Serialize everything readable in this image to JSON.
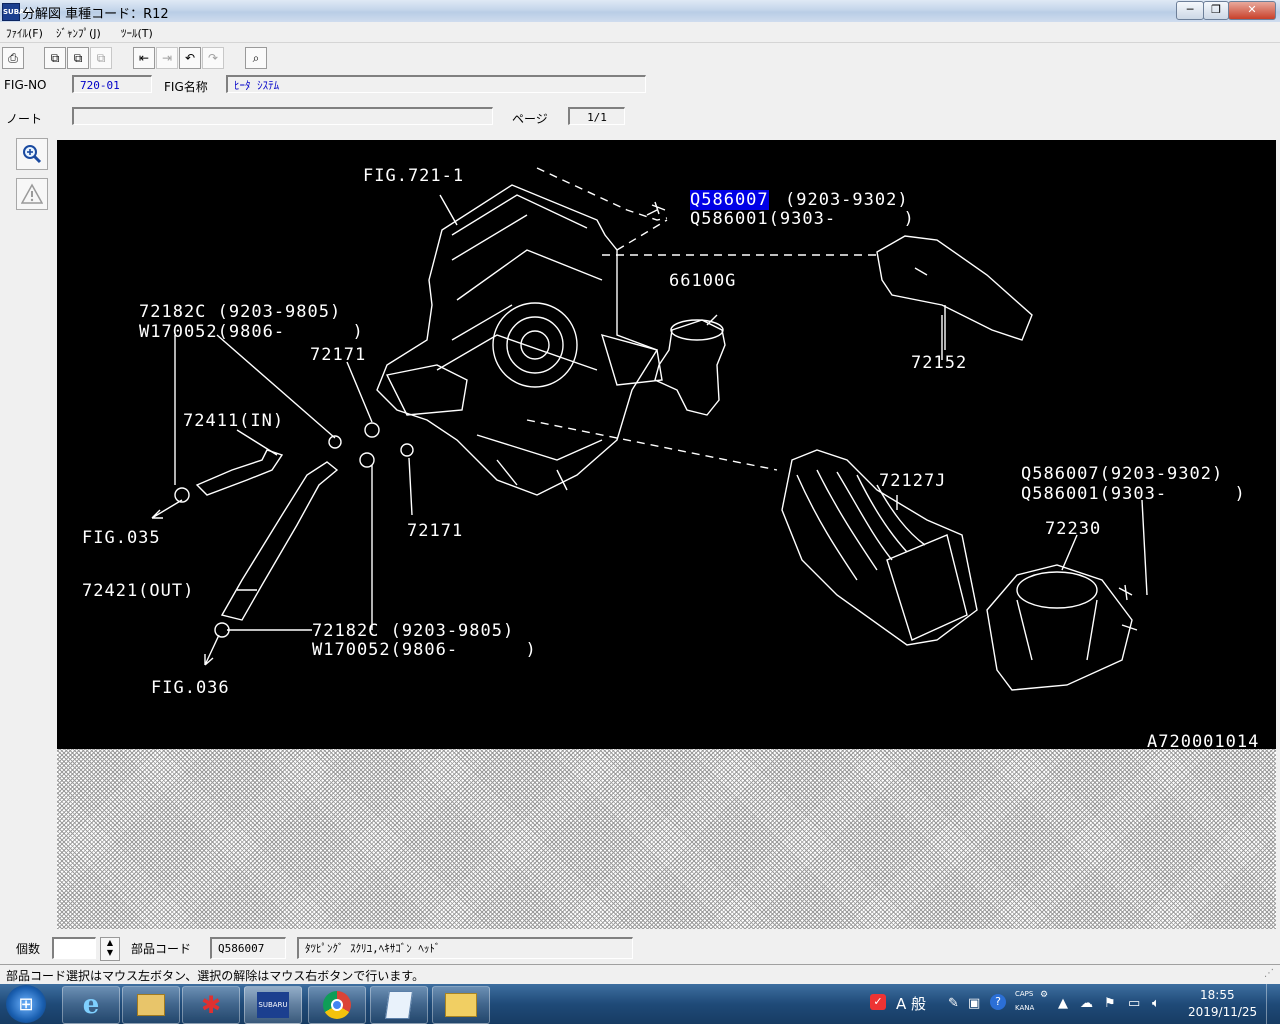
{
  "window": {
    "title": "分解図 車種コード：R12",
    "app_icon_text": "SUBARU",
    "min": "─",
    "max": "❐",
    "close": "✕"
  },
  "menu": [
    "ﾌｧｲﾙ(F)",
    "ｼﾞｬﾝﾌﾟ(J)",
    "ﾂｰﾙ(T)"
  ],
  "fig": {
    "no_label": "FIG-NO",
    "no_value": "720-01",
    "name_label": "FIG名称",
    "name_value": "ﾋｰﾀ ｼｽﾃﾑ",
    "note_label": "ノート",
    "note_value": "",
    "page_label": "ページ",
    "page_value": "1/1"
  },
  "diagram": {
    "labels": {
      "fig721": "FIG.721-1",
      "q586007_sel": "Q586007",
      "q586007_sel_range": "(9203-9302)",
      "q586001_top": "Q586001(9303-      )",
      "p66100g": "66100G",
      "p72152": "72152",
      "p72182c_top": "72182C (9203-9805)",
      "w170052_top": "W170052(9806-      )",
      "p72171_top": "72171",
      "p72411": "72411(IN)",
      "fig035": "FIG.035",
      "p72171_bot": "72171",
      "p72421": "72421(OUT)",
      "p72182c_bot": "72182C (9203-9805)",
      "w170052_bot": "W170052(9806-      )",
      "fig036": "FIG.036",
      "p72127j": "72127J",
      "q586007_right": "Q586007(9203-9302)",
      "q586001_right": "Q586001(9303-      )",
      "p72230": "72230",
      "code": "A720001014"
    }
  },
  "parts": {
    "qty_label": "個数",
    "qty_value": "",
    "code_label": "部品コード",
    "code_value": "Q586007",
    "desc_value": "ﾀﾂﾋﾟﾝｸﾞ ｽｸﾘﾕ,ﾍｷｻｺﾞﾝ ﾍｯﾄﾞ"
  },
  "status": "部品コード選択はマウス左ボタン、選択の解除はマウス右ボタンで行います。",
  "taskbar": {
    "ime": "A 般",
    "caps": "CAPS",
    "kana": "KANA",
    "time": "18:55",
    "date": "2019/11/25"
  },
  "colors": {
    "selection": "#0000e6",
    "field_text": "#0000c8",
    "canvas_bg": "#000000"
  }
}
